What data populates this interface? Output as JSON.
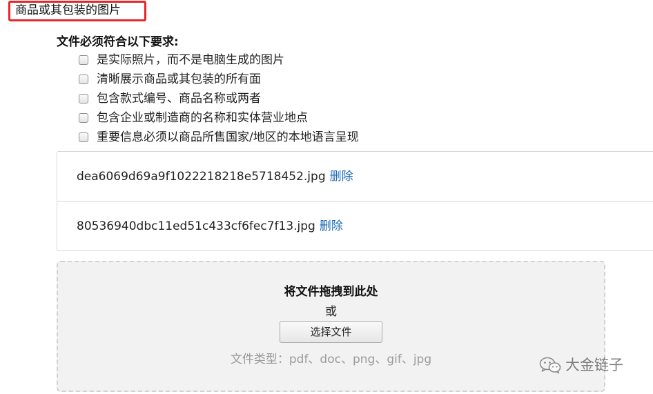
{
  "section": {
    "title": "商品或其包装的图片",
    "highlight_color": "#e8262a"
  },
  "requirements": {
    "heading": "文件必须符合以下要求:",
    "items": [
      {
        "label": "是实际照片，而不是电脑生成的图片",
        "checked": false
      },
      {
        "label": "清晰展示商品或其包装的所有面",
        "checked": false
      },
      {
        "label": "包含款式编号、商品名称或两者",
        "checked": false
      },
      {
        "label": "包含企业或制造商的名称和实体营业地点",
        "checked": false
      },
      {
        "label": "重要信息必须以商品所售国家/地区的本地语言呈现",
        "checked": false
      }
    ]
  },
  "files": [
    {
      "name": "dea6069d69a9f1022218218e5718452.jpg",
      "delete_label": "删除"
    },
    {
      "name": "80536940dbc11ed51c433cf6fec7f13.jpg",
      "delete_label": "删除"
    }
  ],
  "dropzone": {
    "title": "将文件拖拽到此处",
    "or_text": "或",
    "button_label": "选择文件",
    "file_types": "文件类型：pdf、doc、png、gif、jpg"
  },
  "watermark": {
    "text": "大金链子",
    "icon": "wechat-icon"
  },
  "colors": {
    "link": "#1a6ab0",
    "muted_text": "#9a9a9a",
    "dropzone_bg": "#f2f2f2"
  }
}
